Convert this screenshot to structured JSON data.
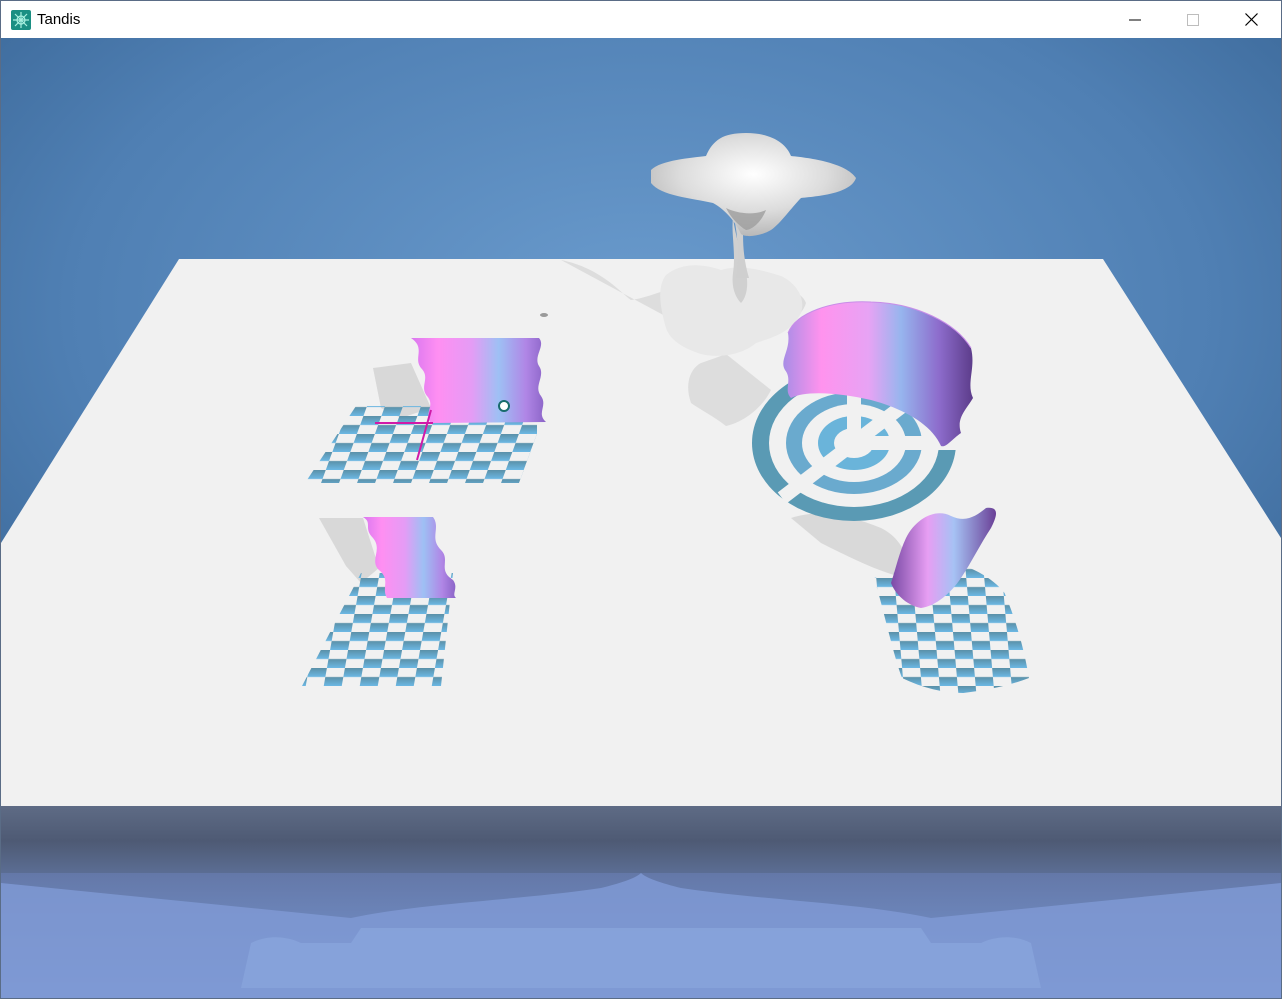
{
  "window": {
    "title": "Tandis",
    "app_icon": "tandis-logo-icon",
    "controls": {
      "minimize_icon": "minimize-icon",
      "maximize_icon": "maximize-icon",
      "close_icon": "close-icon"
    }
  },
  "scene": {
    "sky_color_top": "#3a669b",
    "sky_color_mid": "#6393c6",
    "floor_color": "#f1f1f1",
    "surface_gradient": [
      "#ff88ee",
      "#9bb8f2",
      "#7a4aa6"
    ],
    "checker_color_a": "#5a9ab4",
    "checker_color_b": "#6ab6e2",
    "handle_color": "#d01aa8",
    "objects": [
      "twisted-vase",
      "wavy-sheet-top-left",
      "checker-grid-top-left",
      "wavy-sheet-bottom-left",
      "checker-grid-bottom-left",
      "wavy-cylinder",
      "radial-target-disc",
      "curled-sheet-right",
      "warped-checker-grid-right"
    ]
  }
}
